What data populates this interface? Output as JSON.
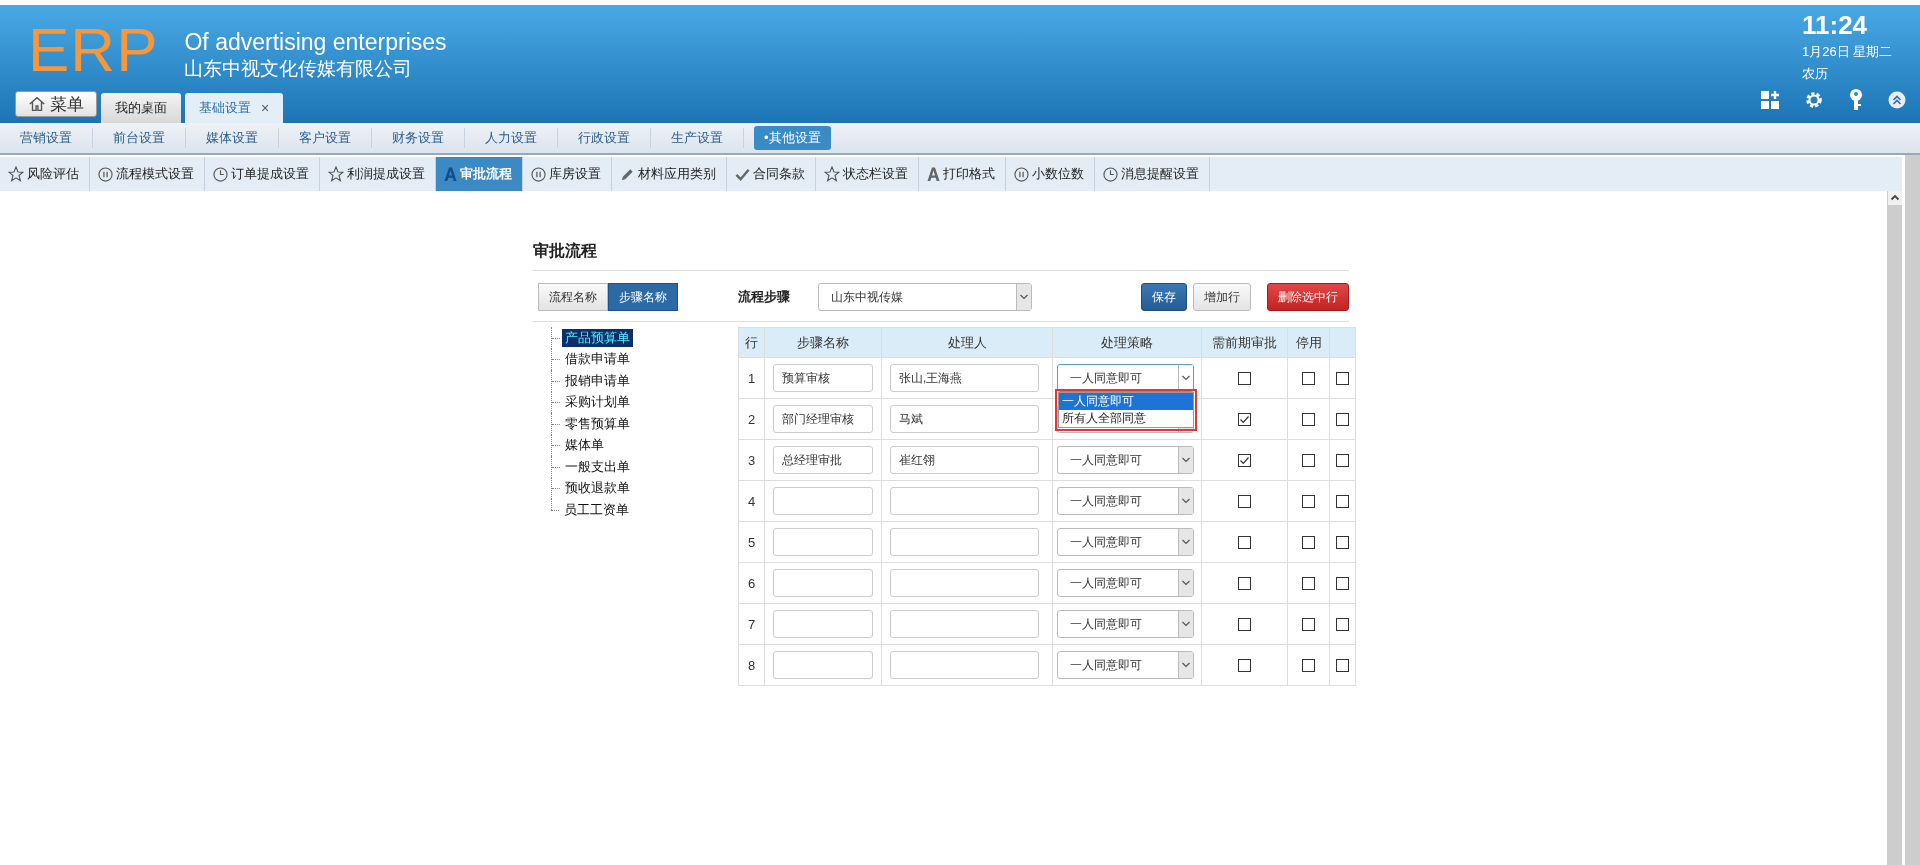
{
  "header": {
    "logo": "ERP",
    "subtitle": "Of advertising enterprises",
    "company": "山东中视文化传媒有限公司",
    "time": "11:24",
    "date": "1月26日 星期二",
    "lunar": "农历"
  },
  "menu_button": "菜单",
  "window_tabs": [
    {
      "label": "我的桌面",
      "selected": false
    },
    {
      "label": "基础设置",
      "selected": true,
      "close": "×"
    }
  ],
  "nav": [
    {
      "label": "营销设置",
      "selected": false
    },
    {
      "label": "前台设置",
      "selected": false
    },
    {
      "label": "媒体设置",
      "selected": false
    },
    {
      "label": "客户设置",
      "selected": false
    },
    {
      "label": "财务设置",
      "selected": false
    },
    {
      "label": "人力设置",
      "selected": false
    },
    {
      "label": "行政设置",
      "selected": false
    },
    {
      "label": "生产设置",
      "selected": false
    },
    {
      "label": "•其他设置",
      "selected": true
    }
  ],
  "sub_tabs": [
    {
      "label": "风险评估",
      "kind": "star",
      "selected": false
    },
    {
      "label": "流程模式设置",
      "kind": "pause",
      "selected": false
    },
    {
      "label": "订单提成设置",
      "kind": "clock",
      "selected": false
    },
    {
      "label": "利润提成设置",
      "kind": "star",
      "selected": false
    },
    {
      "label": "审批流程",
      "kind": "font",
      "selected": true
    },
    {
      "label": "库房设置",
      "kind": "pause",
      "selected": false
    },
    {
      "label": "材料应用类别",
      "kind": "pencil",
      "selected": false
    },
    {
      "label": "合同条款",
      "kind": "check",
      "selected": false
    },
    {
      "label": "状态栏设置",
      "kind": "star",
      "selected": false
    },
    {
      "label": "打印格式",
      "kind": "font",
      "selected": false
    },
    {
      "label": "小数位数",
      "kind": "pause",
      "selected": false
    },
    {
      "label": "消息提醒设置",
      "kind": "clock",
      "selected": false
    }
  ],
  "page": {
    "title": "审批流程",
    "toggle": [
      {
        "label": "流程名称",
        "selected": false
      },
      {
        "label": "步骤名称",
        "selected": true
      }
    ],
    "step_label": "流程步骤",
    "step_select": "山东中视传媒",
    "buttons": [
      {
        "label": "保存",
        "kind": "primary"
      },
      {
        "label": "增加行",
        "kind": "default"
      },
      {
        "label": "删除选中行",
        "kind": "danger"
      }
    ],
    "tree": [
      {
        "label": "产品预算单",
        "selected": true
      },
      {
        "label": "借款申请单",
        "selected": false
      },
      {
        "label": "报销申请单",
        "selected": false
      },
      {
        "label": "采购计划单",
        "selected": false
      },
      {
        "label": "零售预算单",
        "selected": false
      },
      {
        "label": "媒体单",
        "selected": false
      },
      {
        "label": "一般支出单",
        "selected": false
      },
      {
        "label": "预收退款单",
        "selected": false
      },
      {
        "label": "员工工资单",
        "selected": false
      }
    ],
    "table": {
      "columns": [
        "行",
        "步骤名称",
        "处理人",
        "处理策略",
        "需前期审批",
        "停用"
      ],
      "rows": [
        {
          "no": "1",
          "step": "预算审核",
          "handler": "张山,王海燕",
          "strategy": "一人同意即可",
          "prior": false,
          "disabled": false,
          "selected": false,
          "open": true,
          "options": [
            {
              "label": "一人同意即可",
              "selected": true
            },
            {
              "label": "所有人全部同意",
              "selected": false
            }
          ]
        },
        {
          "no": "2",
          "step": "部门经理审核",
          "handler": "马斌",
          "prior": true,
          "disabled": false,
          "selected": false,
          "open": false
        },
        {
          "no": "3",
          "step": "总经理审批",
          "handler": "崔红翎",
          "strategy": "一人同意即可",
          "prior": true,
          "disabled": false,
          "selected": false,
          "open": false
        },
        {
          "no": "4",
          "strategy": "一人同意即可",
          "prior": false,
          "disabled": false,
          "selected": false,
          "open": false
        },
        {
          "no": "5",
          "strategy": "一人同意即可",
          "prior": false,
          "disabled": false,
          "selected": false,
          "open": false
        },
        {
          "no": "6",
          "strategy": "一人同意即可",
          "prior": false,
          "disabled": false,
          "selected": false,
          "open": false
        },
        {
          "no": "7",
          "strategy": "一人同意即可",
          "prior": false,
          "disabled": false,
          "selected": false,
          "open": false
        },
        {
          "no": "8",
          "strategy": "一人同意即可",
          "prior": false,
          "disabled": false,
          "selected": false,
          "open": false
        }
      ]
    }
  }
}
